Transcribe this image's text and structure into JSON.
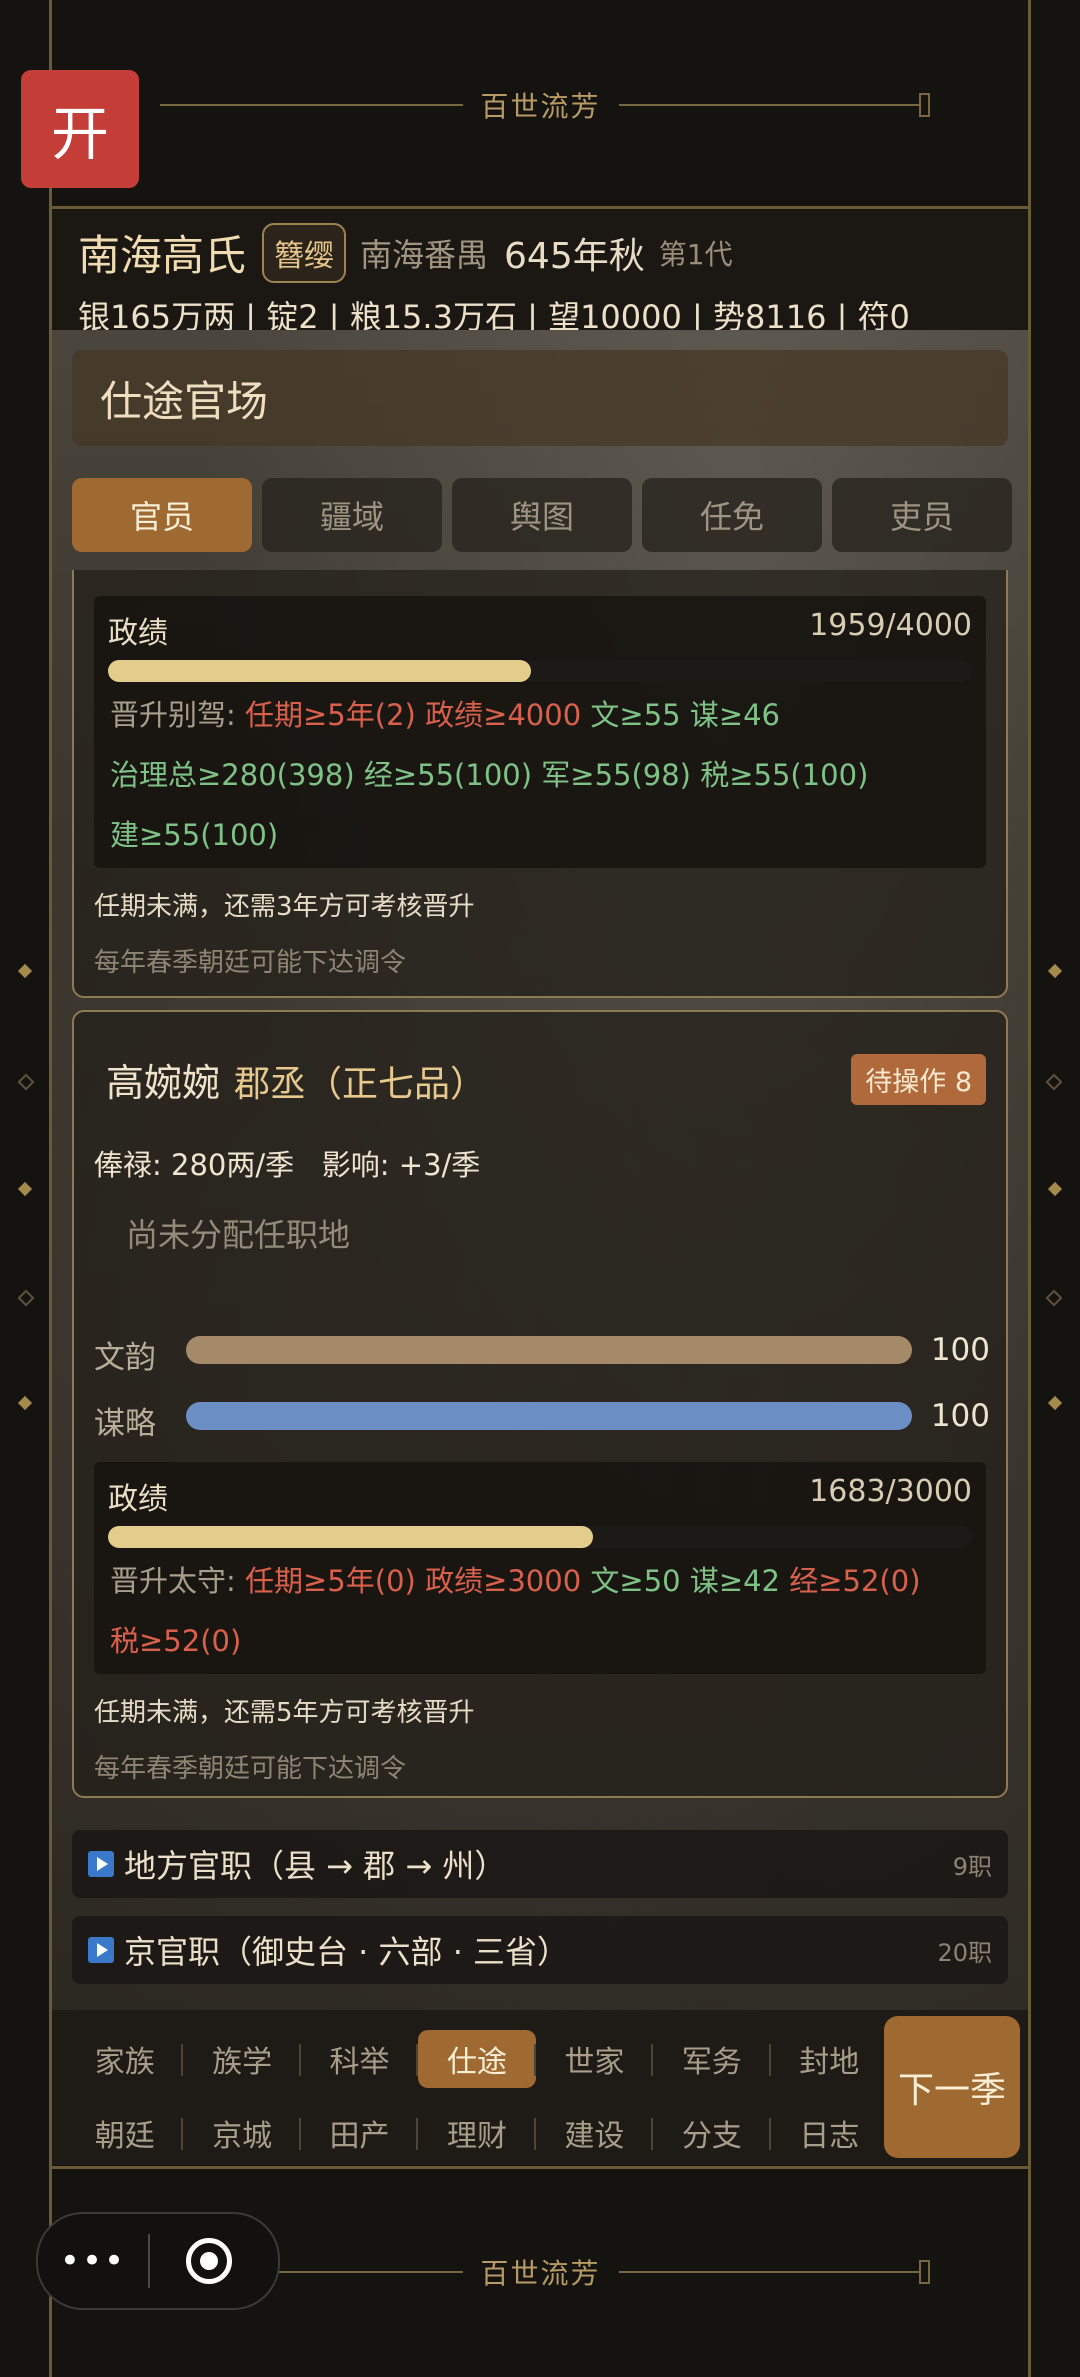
{
  "top_banner": {
    "open_button": "开",
    "title": "百世流芳"
  },
  "header": {
    "clan_name": "南海高氏",
    "rank_badge": "簪缨",
    "location": "南海番禺",
    "date": "645年秋",
    "generation": "第1代",
    "resources": "银165万两 | 锭2 | 粮15.3万石 | 望10000 | 势8116 | 符0"
  },
  "section": {
    "title": "仕途官场"
  },
  "tabs": [
    {
      "label": "官员",
      "active": true
    },
    {
      "label": "疆域",
      "active": false
    },
    {
      "label": "舆图",
      "active": false
    },
    {
      "label": "任免",
      "active": false
    },
    {
      "label": "吏员",
      "active": false
    }
  ],
  "official_1": {
    "merit_label": "政绩",
    "merit_value": "1959/4000",
    "merit_progress": 0.49,
    "promotion_prefix": "晋升别驾:",
    "req_term": "任期≥5年(2)",
    "req_merit": "政绩≥4000",
    "req_wen": "文≥55",
    "req_mou": "谋≥46",
    "req_zhili": "治理总≥280(398)",
    "req_jing": "经≥55(100)",
    "req_jun": "军≥55(98)",
    "req_shui": "税≥55(100)",
    "req_jian": "建≥55(100)",
    "note_term": "任期未满，还需3年方可考核晋升",
    "note_court": "每年春季朝廷可能下达调令"
  },
  "official_2": {
    "name": "高婉婉",
    "post": "郡丞（正七品）",
    "pending": "待操作 8",
    "salary": "俸禄: 280两/季",
    "influence": "影响: +3/季",
    "unassigned": "尚未分配任职地",
    "attr_wen_label": "文韵",
    "attr_wen_value": "100",
    "attr_mou_label": "谋略",
    "attr_mou_value": "100",
    "merit_label": "政绩",
    "merit_value": "1683/3000",
    "merit_progress": 0.561,
    "promotion_prefix": "晋升太守:",
    "req_term": "任期≥5年(0)",
    "req_merit": "政绩≥3000",
    "req_wen": "文≥50",
    "req_mou": "谋≥42",
    "req_jing": "经≥52(0)",
    "req_shui": "税≥52(0)",
    "note_term": "任期未满，还需5年方可考核晋升",
    "note_court": "每年春季朝廷可能下达调令"
  },
  "groups": [
    {
      "label": "地方官职（县 → 郡 → 州）",
      "count": "9职"
    },
    {
      "label": "京官职（御史台 · 六部 · 三省）",
      "count": "20职"
    }
  ],
  "nav": {
    "row1": [
      "家族",
      "族学",
      "科举",
      "仕途",
      "世家",
      "军务",
      "封地"
    ],
    "row2": [
      "朝廷",
      "京城",
      "田产",
      "理财",
      "建设",
      "分支",
      "日志"
    ],
    "active": "仕途",
    "next_button": "下一季"
  },
  "bottom_banner": {
    "title": "百世流芳"
  },
  "colors": {
    "accent": "#9f6a31",
    "red": "#d9604b",
    "green": "#7ec285",
    "wen_bar": "#a48a68",
    "mou_bar": "#6b8fc4"
  }
}
